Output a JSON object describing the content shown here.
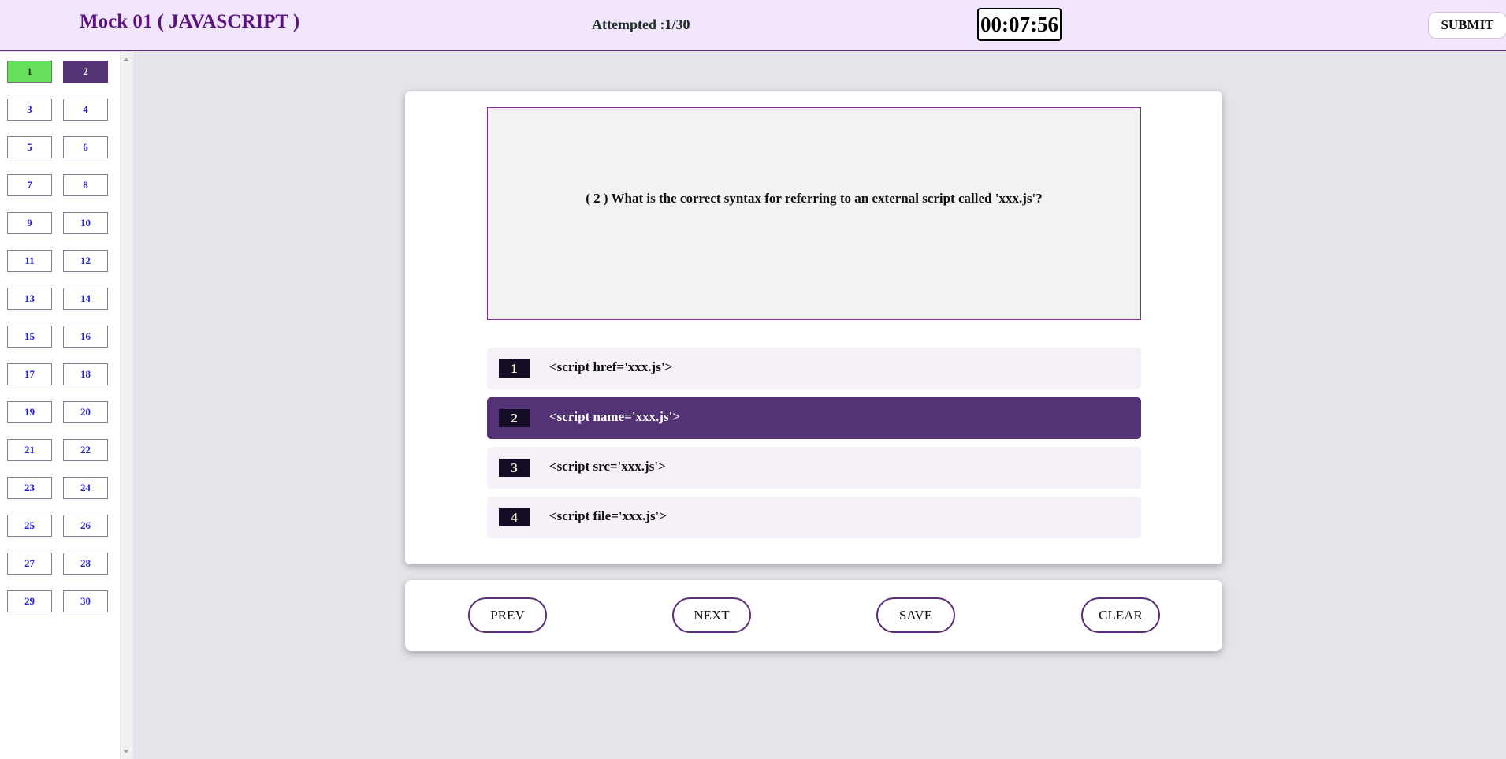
{
  "header": {
    "title": "Mock 01 ( JAVASCRIPT )",
    "attempted": "Attempted :1/30",
    "timer": "00:07:56",
    "submit_label": "SUBMIT"
  },
  "sidebar": {
    "questions": [
      "1",
      "2",
      "3",
      "4",
      "5",
      "6",
      "7",
      "8",
      "9",
      "10",
      "11",
      "12",
      "13",
      "14",
      "15",
      "16",
      "17",
      "18",
      "19",
      "20",
      "21",
      "22",
      "23",
      "24",
      "25",
      "26",
      "27",
      "28",
      "29",
      "30"
    ],
    "answered": [
      "1"
    ],
    "current": "2"
  },
  "question": {
    "text": "( 2 )  What is the correct syntax for referring to an external script called 'xxx.js'?",
    "options": [
      {
        "num": "1",
        "text": "<script href='xxx.js'>"
      },
      {
        "num": "2",
        "text": "<script name='xxx.js'>"
      },
      {
        "num": "3",
        "text": "<script src='xxx.js'>"
      },
      {
        "num": "4",
        "text": "<script file='xxx.js'>"
      }
    ],
    "selected": "2"
  },
  "nav": {
    "prev_label": "PREV",
    "next_label": "NEXT",
    "save_label": "SAVE",
    "clear_label": "CLEAR"
  }
}
